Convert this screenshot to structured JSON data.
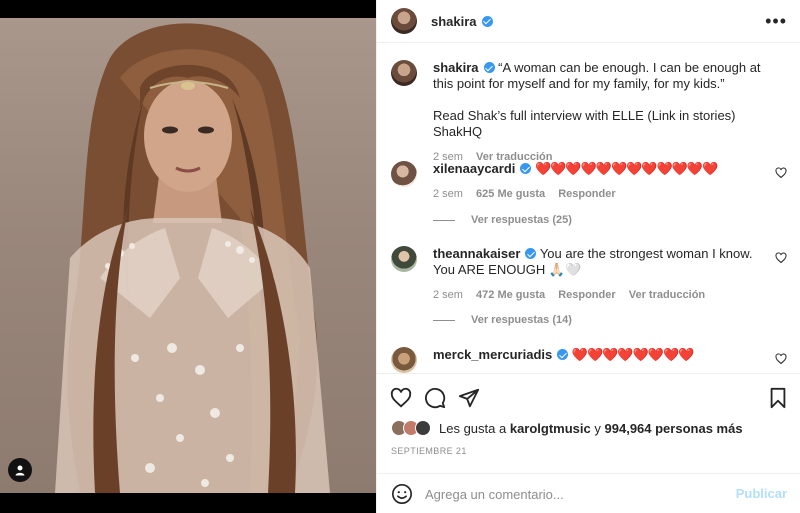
{
  "post": {
    "author": "shakira",
    "more_icon": "more-horizontal-icon"
  },
  "caption": {
    "username": "shakira",
    "text": "“A woman can be enough. I can be enough at this point for myself and for my family, for my kids.”",
    "text2": "Read Shak’s full interview with ELLE (Link in stories) ShakHQ",
    "time": "2 sem",
    "translate": "Ver traducción"
  },
  "comments": [
    {
      "username": "xilenaaycardi",
      "text": "❤️❤️❤️❤️❤️❤️❤️❤️❤️❤️❤️❤️",
      "time": "2 sem",
      "likes": "625 Me gusta",
      "reply": "Responder",
      "replies": "Ver respuestas (25)"
    },
    {
      "username": "theannakaiser",
      "text": "You are the strongest woman I know. You ARE ENOUGH 🙏🏻🤍",
      "time": "2 sem",
      "likes": "472 Me gusta",
      "reply": "Responder",
      "translate": "Ver traducción",
      "replies": "Ver respuestas (14)"
    },
    {
      "username": "merck_mercuriadis",
      "text": "❤️❤️❤️❤️❤️❤️❤️❤️"
    }
  ],
  "likes_line": {
    "prefix": "Les gusta a",
    "user": "karolgtmusic",
    "middle": "y",
    "count": "994,964 personas más"
  },
  "date": "SEPTIEMBRE 21",
  "composer": {
    "placeholder": "Agrega un comentario...",
    "publish": "Publicar"
  },
  "colors": {
    "verified": "#3897f0",
    "heart": "#ed4956",
    "muted": "#8e8e8e",
    "publish_disabled": "#b2dffc"
  }
}
